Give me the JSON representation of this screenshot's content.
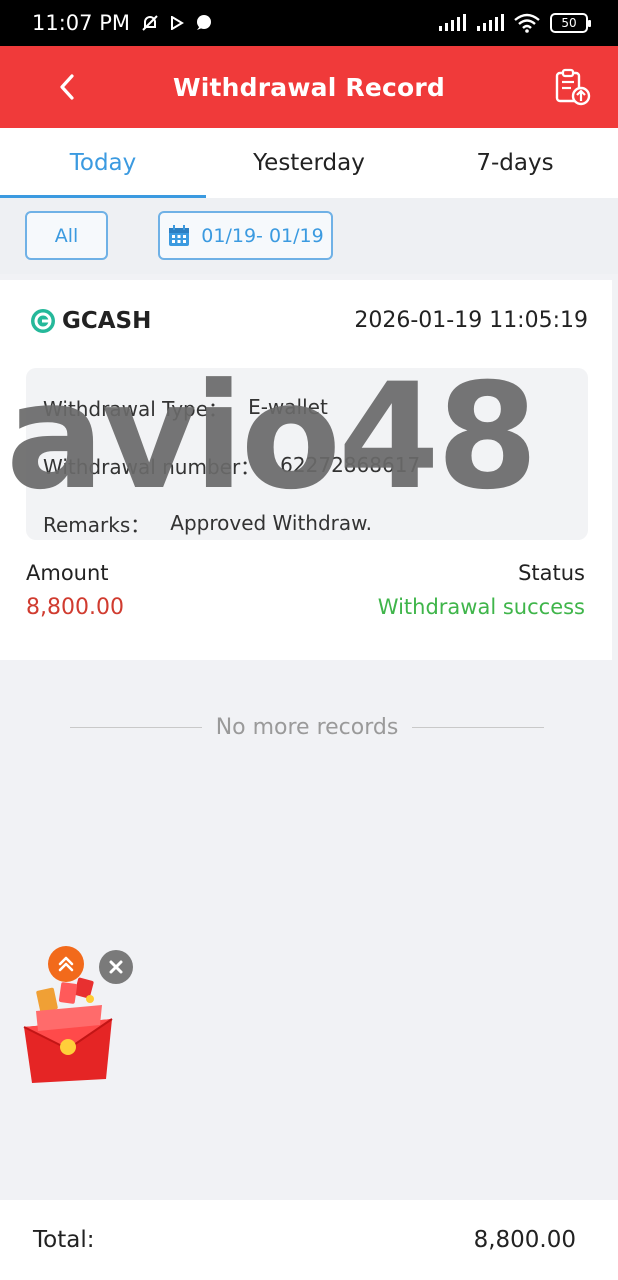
{
  "statusbar": {
    "time": "11:07 PM",
    "battery": "50",
    "icons": [
      "mute-bell-icon",
      "play-icon",
      "chat-bubble-icon",
      "signal-icon",
      "signal-icon",
      "wifi-icon",
      "battery-icon"
    ]
  },
  "header": {
    "title": "Withdrawal Record",
    "back_icon": "chevron-left-icon",
    "action_icon": "clipboard-upload-icon",
    "color": "#f03a3a"
  },
  "tabs": [
    {
      "label": "Today",
      "active": true
    },
    {
      "label": "Yesterday",
      "active": false
    },
    {
      "label": "7-days",
      "active": false
    }
  ],
  "filter": {
    "all_label": "All",
    "date_range": "01/19- 01/19",
    "calendar_icon": "calendar-icon"
  },
  "record": {
    "provider": "GCASH",
    "datetime": "2026-01-19 11:05:19",
    "details": [
      {
        "label": "Withdrawal Type：",
        "value": "E-wallet"
      },
      {
        "label": "Withdrawal number：",
        "value": "62272868617"
      },
      {
        "label": "Remarks：",
        "value": "Approved Withdraw."
      }
    ],
    "amount_label": "Amount",
    "amount": "8,800.00",
    "status_label": "Status",
    "status": "Withdrawal success",
    "status_color": "#3fb54a",
    "amount_color": "#d03b2f"
  },
  "list_end_text": "No more records",
  "watermark": "avio48",
  "floating": {
    "up_icon": "double-chevron-up-icon",
    "close_icon": "close-icon",
    "gift_icon": "red-envelope-gift-icon"
  },
  "total": {
    "label": "Total:",
    "value": "8,800.00"
  },
  "accent_color": "#3b9ae0"
}
